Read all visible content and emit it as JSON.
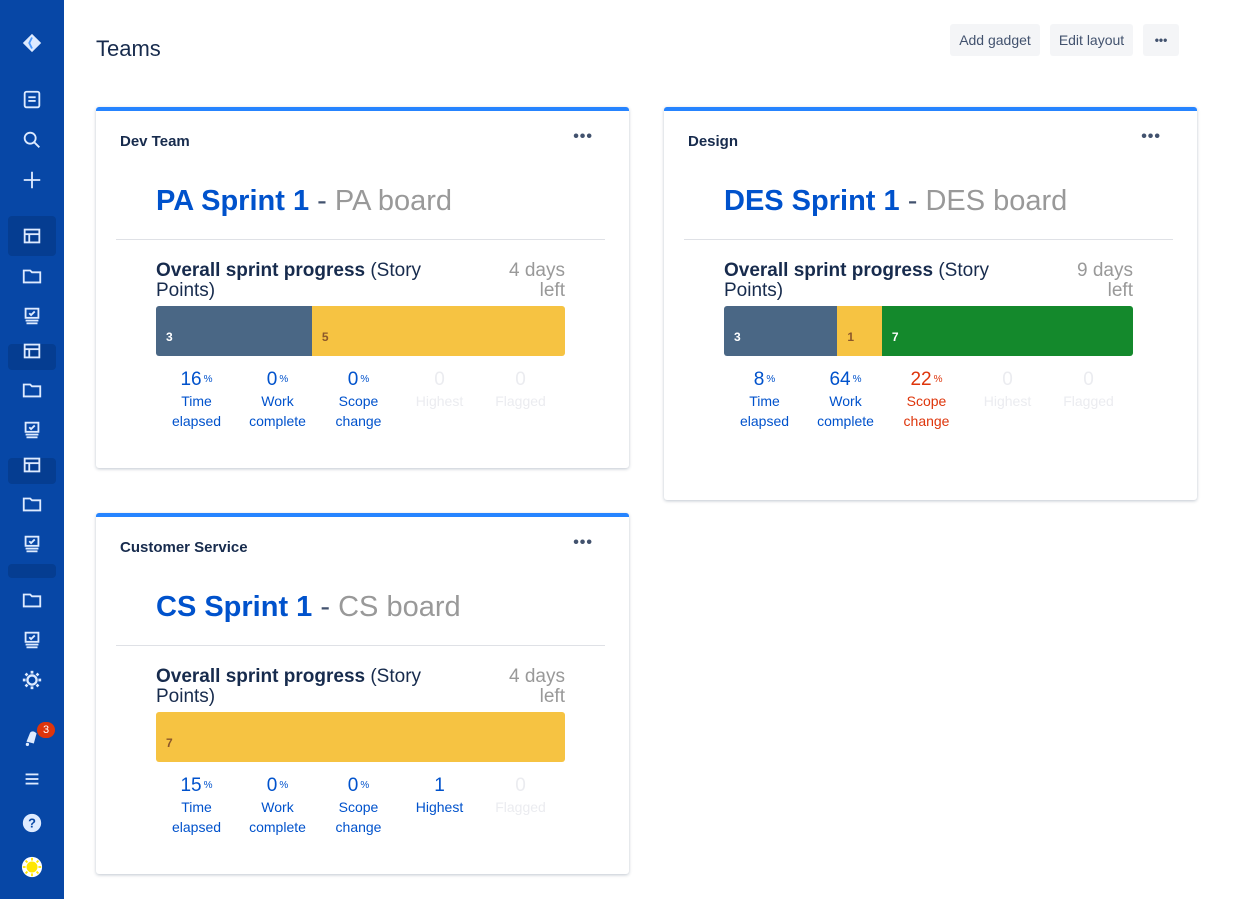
{
  "sidebar": {
    "logo": "jira-logo-icon",
    "items": [
      {
        "icon": "dashboard-icon",
        "label": "Dashboards"
      },
      {
        "icon": "search-icon",
        "label": "Search"
      },
      {
        "icon": "plus-icon",
        "label": "Create"
      },
      {
        "icon": "board-icon",
        "label": "Board",
        "selected": true
      },
      {
        "icon": "folder-icon",
        "label": "Project"
      },
      {
        "icon": "backlog-icon",
        "label": "Backlog"
      },
      {
        "icon": "board-icon",
        "label": "Board"
      },
      {
        "icon": "folder-icon",
        "label": "Project"
      },
      {
        "icon": "backlog-icon",
        "label": "Backlog"
      },
      {
        "icon": "board-icon",
        "label": "Board"
      },
      {
        "icon": "folder-icon",
        "label": "Project"
      },
      {
        "icon": "backlog-icon",
        "label": "Backlog"
      },
      {
        "icon": "folder-icon",
        "label": "Project"
      },
      {
        "icon": "backlog-icon",
        "label": "Backlog"
      },
      {
        "icon": "gear-icon",
        "label": "Settings"
      }
    ],
    "notifications": {
      "icon": "notification-icon",
      "count": "3"
    },
    "menu_icon": "menu-icon",
    "help_icon": "help-icon",
    "avatar": "user-avatar"
  },
  "header": {
    "title": "Teams",
    "add_gadget": "Add gadget",
    "edit_layout": "Edit layout",
    "more": "•••"
  },
  "colors": {
    "done": "#4a6785",
    "in_progress": "#f6c342",
    "todo_green": "#14892c",
    "link_blue": "#0052cc",
    "alert_red": "#de350b",
    "accent": "#2684ff"
  },
  "gadgets": [
    {
      "title": "Dev Team",
      "more": "•••",
      "sprint": "PA Sprint 1",
      "separator": "-",
      "board": "PA board",
      "progress_bold": "Overall sprint progress",
      "progress_rest": " (Story Points)",
      "days_left": "4 days left",
      "segments": [
        {
          "value": 3,
          "label": "3",
          "status": "done"
        },
        {
          "value": 5,
          "label": "5",
          "status": "in_progress"
        }
      ],
      "stats": [
        {
          "num": "16",
          "pct": "%",
          "label": "Time elapsed",
          "state": "blue"
        },
        {
          "num": "0",
          "pct": "%",
          "label": "Work complete",
          "state": "blue"
        },
        {
          "num": "0",
          "pct": "%",
          "label": "Scope change",
          "state": "blue"
        },
        {
          "num": "0",
          "pct": "",
          "label": "Highest",
          "state": "dim"
        },
        {
          "num": "0",
          "pct": "",
          "label": "Flagged",
          "state": "dim"
        }
      ]
    },
    {
      "title": "Design",
      "more": "•••",
      "sprint": "DES Sprint 1",
      "separator": "-",
      "board": "DES board",
      "progress_bold": "Overall sprint progress",
      "progress_rest": " (Story Points)",
      "days_left": "9 days left",
      "segments": [
        {
          "value": 3,
          "label": "3",
          "status": "done"
        },
        {
          "value": 1,
          "label": "1",
          "status": "in_progress"
        },
        {
          "value": 7,
          "label": "7",
          "status": "todo_green"
        }
      ],
      "stats": [
        {
          "num": "8",
          "pct": "%",
          "label": "Time elapsed",
          "state": "blue"
        },
        {
          "num": "64",
          "pct": "%",
          "label": "Work complete",
          "state": "blue"
        },
        {
          "num": "22",
          "pct": "%",
          "label": "Scope change",
          "state": "red"
        },
        {
          "num": "0",
          "pct": "",
          "label": "Highest",
          "state": "dim"
        },
        {
          "num": "0",
          "pct": "",
          "label": "Flagged",
          "state": "dim"
        }
      ]
    },
    {
      "title": "Customer Service",
      "more": "•••",
      "sprint": "CS Sprint 1",
      "separator": "-",
      "board": "CS board",
      "progress_bold": "Overall sprint progress",
      "progress_rest": " (Story Points)",
      "days_left": "4 days left",
      "segments": [
        {
          "value": 7,
          "label": "7",
          "status": "in_progress"
        }
      ],
      "stats": [
        {
          "num": "15",
          "pct": "%",
          "label": "Time elapsed",
          "state": "blue"
        },
        {
          "num": "0",
          "pct": "%",
          "label": "Work complete",
          "state": "blue"
        },
        {
          "num": "0",
          "pct": "%",
          "label": "Scope change",
          "state": "blue"
        },
        {
          "num": "1",
          "pct": "",
          "label": "Highest",
          "state": "blue"
        },
        {
          "num": "0",
          "pct": "",
          "label": "Flagged",
          "state": "dim"
        }
      ]
    }
  ]
}
